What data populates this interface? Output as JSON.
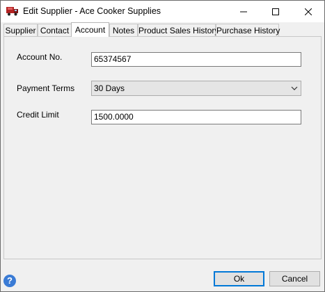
{
  "window": {
    "title": "Edit Supplier - Ace Cooker Supplies",
    "app_icon": "delivery-truck-icon",
    "controls": [
      "minimize-icon",
      "maximize-icon",
      "close-icon"
    ]
  },
  "tabs": [
    {
      "label": "Supplier",
      "active": false
    },
    {
      "label": "Contact",
      "active": false
    },
    {
      "label": "Account",
      "active": true
    },
    {
      "label": "Notes",
      "active": false
    },
    {
      "label": "Product Sales History",
      "active": false
    },
    {
      "label": "Purchase History",
      "active": false
    }
  ],
  "account": {
    "account_no_label": "Account No.",
    "account_no_value": "65374567",
    "payment_terms_label": "Payment Terms",
    "payment_terms_value": "30 Days",
    "credit_limit_label": "Credit Limit",
    "credit_limit_value": "1500.0000"
  },
  "footer": {
    "help_icon": "help-icon",
    "help_glyph": "?",
    "ok_label": "Ok",
    "cancel_label": "Cancel"
  },
  "colors": {
    "accent": "#0078d7",
    "window_bg": "#f0f0f0",
    "help_blue": "#3a7bd5"
  }
}
